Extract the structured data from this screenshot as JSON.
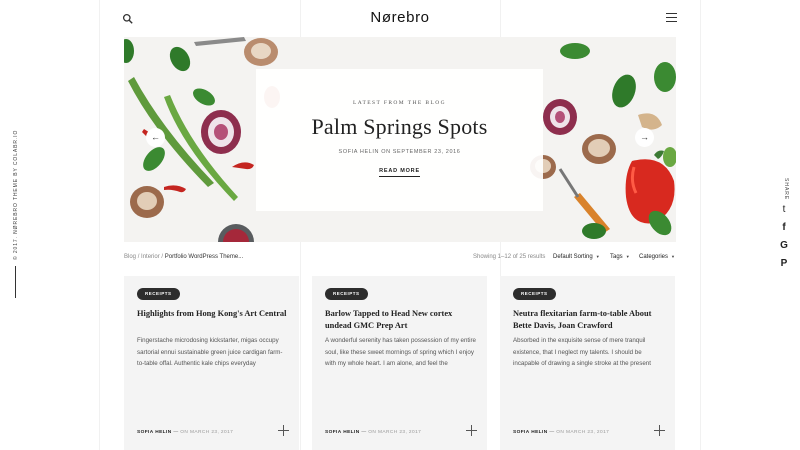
{
  "header": {
    "logo": "Nørebro"
  },
  "sidebar": {
    "credit": "© 2017. NØREBRO THEME BY COLABR.IO"
  },
  "share": {
    "label": "SHARE",
    "icons": [
      "twitter-icon",
      "facebook-icon",
      "google-icon",
      "pinterest-icon"
    ],
    "glyphs": [
      "t",
      "f",
      "G",
      "P"
    ]
  },
  "hero": {
    "eyebrow": "LATEST FROM THE BLOG",
    "title": "Palm Springs Spots",
    "meta": "SOFIA HELIN ON SEPTEMBER 23, 2016",
    "cta": "READ MORE",
    "prev_glyph": "←",
    "next_glyph": "→"
  },
  "breadcrumb": {
    "items": [
      "Blog",
      "Interior"
    ],
    "current": "Portfolio WordPress Theme...",
    "separator": "/"
  },
  "toolbar": {
    "results": "Showing 1–12 of 25 results",
    "sort": "Default Sorting",
    "tags": "Tags",
    "categories": "Categories"
  },
  "posts": [
    {
      "category": "RECEIPTS",
      "title": "Highlights from Hong Kong's Art Central",
      "excerpt": "Fingerstache microdosing kickstarter, migas occupy sartorial ennui sustainable green juice cardigan farm-to-table offal. Authentic kale chips everyday",
      "author": "SOFIA HELIN",
      "date": "ON MARCH 23, 2017"
    },
    {
      "category": "RECEIPTS",
      "title": "Barlow Tapped to Head New cortex undead GMC Prep Art",
      "excerpt": "A wonderful serenity has taken possession of my entire soul, like these sweet mornings of spring which I enjoy with my whole heart. I am alone, and feel the",
      "author": "SOFIA HELIN",
      "date": "ON MARCH 23, 2017"
    },
    {
      "category": "RECEIPTS",
      "title": "Neutra flexitarian farm-to-table About Bette Davis, Joan Crawford",
      "excerpt": "Absorbed in the exquisite sense of mere tranquil existence, that I neglect my talents. I should be incapable of drawing a single stroke at the present",
      "author": "SOFIA HELIN",
      "date": "ON MARCH 23, 2017"
    }
  ],
  "colors": {
    "badge": "#2d2d2d",
    "card_bg": "#f4f4f4",
    "hero_bg": "#f4f3f1",
    "pepper_red": "#d8291f",
    "leaf_green": "#3c7a34"
  }
}
